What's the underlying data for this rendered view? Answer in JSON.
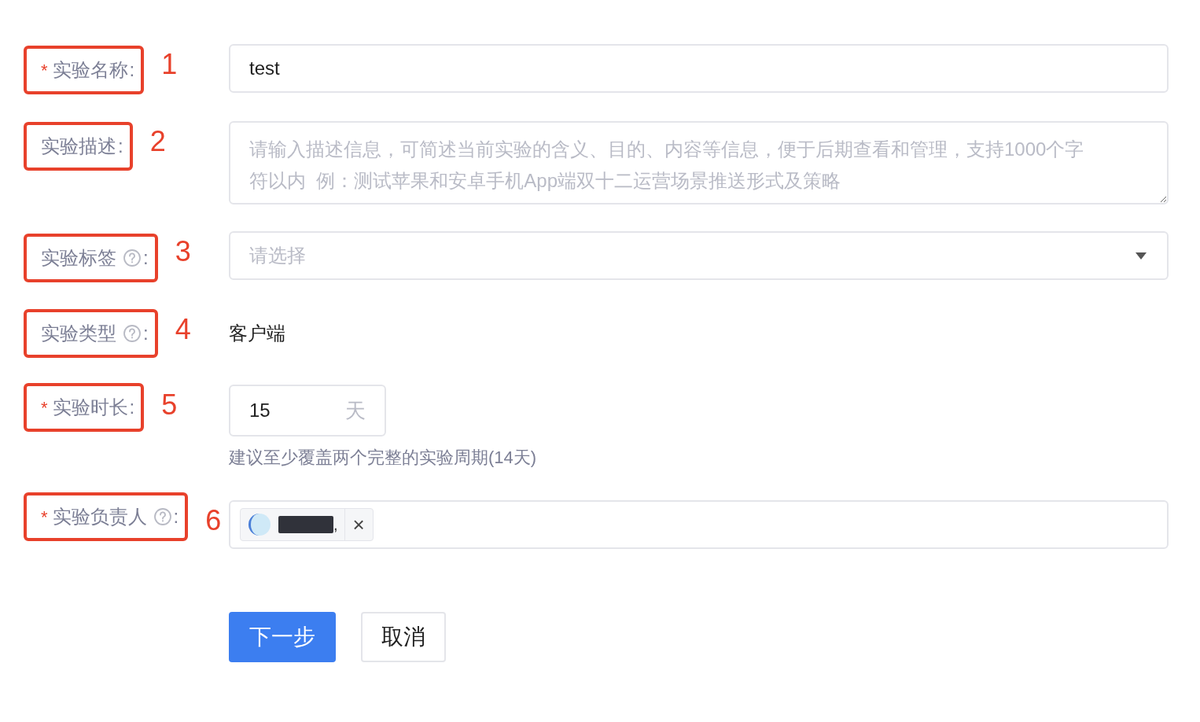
{
  "fields": [
    {
      "kind": "text",
      "annotation": "1",
      "mark": "*",
      "label": "实验名称",
      "help": false,
      "colon": ":",
      "value": "test"
    },
    {
      "kind": "textarea",
      "annotation": "2",
      "label": "实验描述",
      "help": false,
      "colon": ":",
      "placeholder": "请输入描述信息，可简述当前实验的含义、目的、内容等信息，便于后期查看和管理，支持1000个字符以内  例：测试苹果和安卓手机App端双十二运营场景推送形式及策略"
    },
    {
      "kind": "select",
      "annotation": "3",
      "label": "实验标签",
      "help": true,
      "colon": ":",
      "placeholder": "请选择"
    },
    {
      "kind": "static",
      "annotation": "4",
      "label": "实验类型",
      "help": true,
      "colon": ":",
      "value": "客户端"
    },
    {
      "kind": "number",
      "annotation": "5",
      "mark": "*",
      "label": "实验时长",
      "help": false,
      "colon": ":",
      "value": "15",
      "unit": "天",
      "hint": "建议至少覆盖两个完整的实验周期(14天)"
    },
    {
      "kind": "tags",
      "annotation": "6",
      "mark": "*",
      "label": "实验负责人",
      "help": true,
      "colon": ":",
      "tags": [
        {
          "suffix": ",",
          "close": "×"
        }
      ]
    }
  ],
  "buttons": [
    {
      "label": "下一步",
      "primary": true
    },
    {
      "label": "取消",
      "primary": false
    }
  ]
}
